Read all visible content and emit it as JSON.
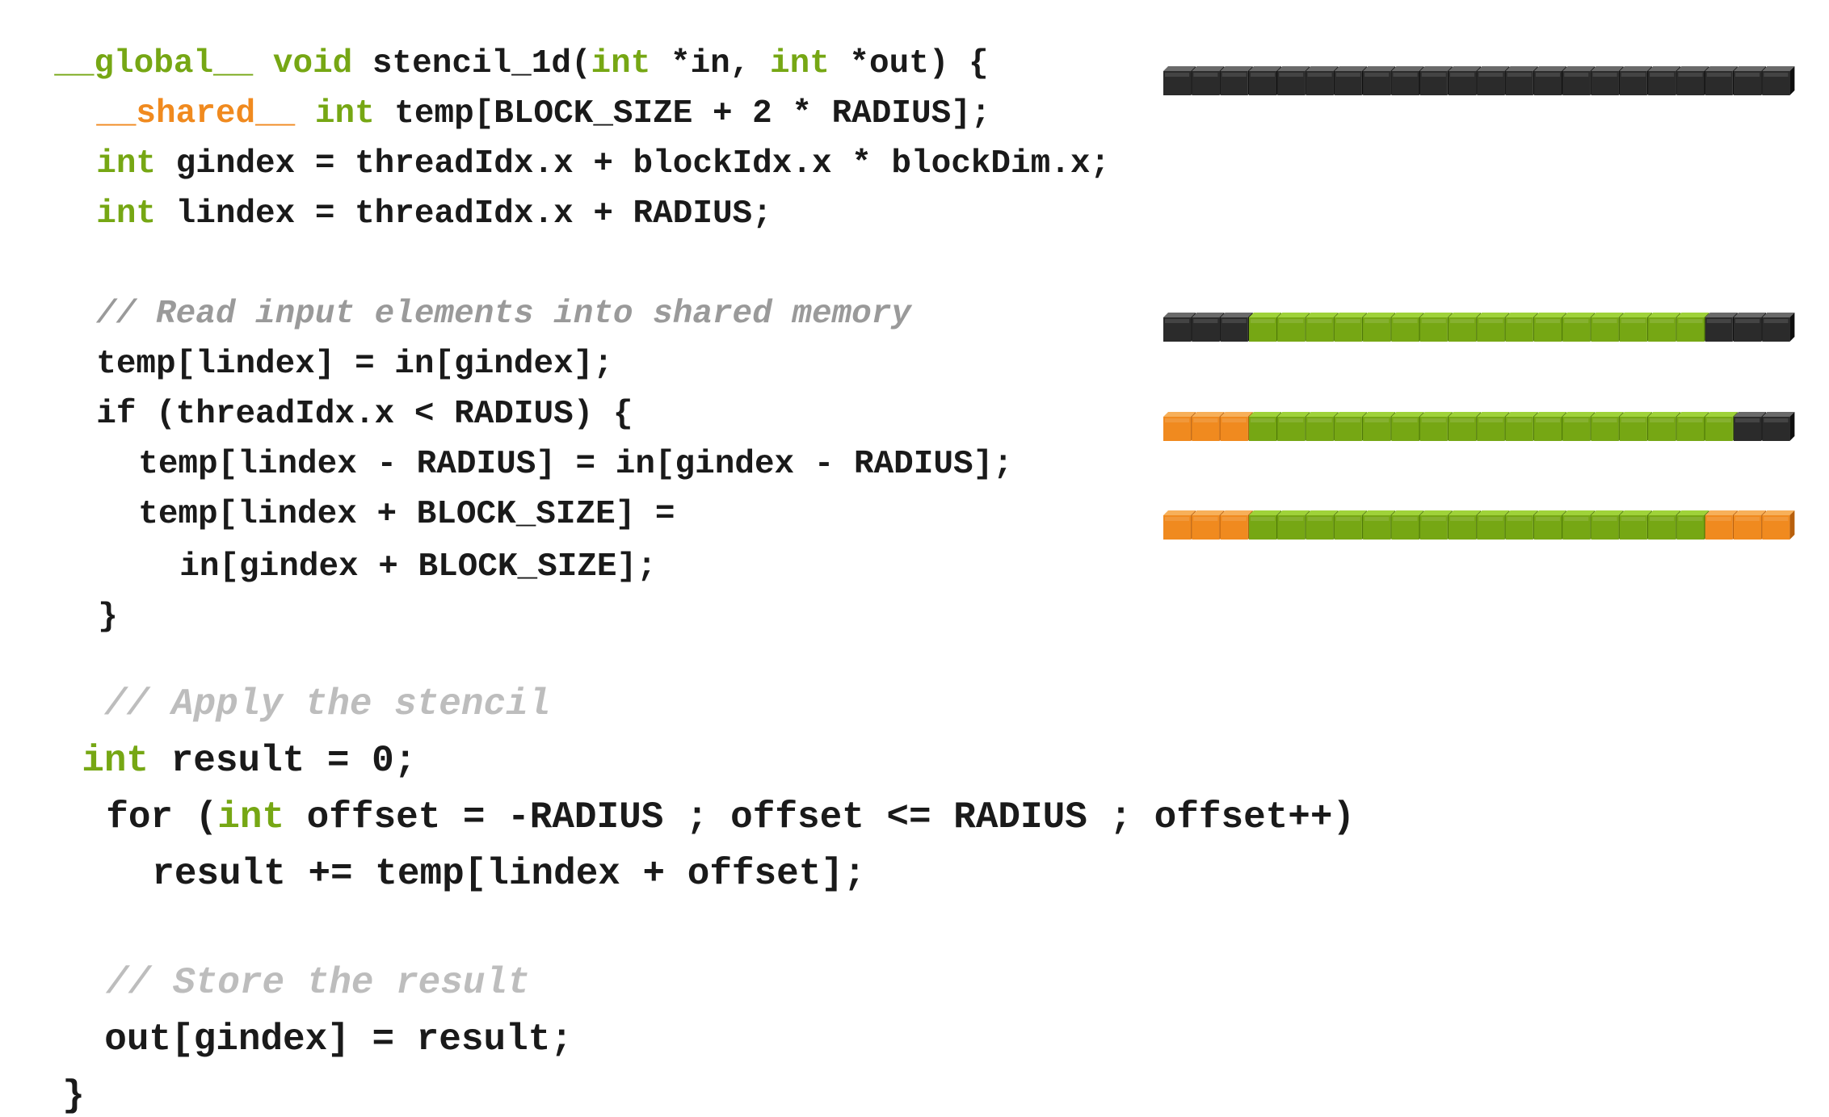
{
  "code": {
    "lines": [
      {
        "id": "l1",
        "size": "s1",
        "tokens": [
          {
            "text": "__global__",
            "c": "green"
          },
          {
            "text": " "
          },
          {
            "text": "void",
            "c": "green"
          },
          {
            "text": " stencil_1d("
          },
          {
            "text": "int",
            "c": "green"
          },
          {
            "text": " *in, "
          },
          {
            "text": "int",
            "c": "green"
          },
          {
            "text": " *out) {"
          }
        ]
      },
      {
        "id": "l2",
        "size": "s1",
        "tokens": [
          {
            "text": "__shared__",
            "c": "orange"
          },
          {
            "text": " "
          },
          {
            "text": "int",
            "c": "green"
          },
          {
            "text": " temp[BLOCK_SIZE + 2 * RADIUS];"
          }
        ]
      },
      {
        "id": "l3",
        "size": "s1",
        "tokens": [
          {
            "text": "int",
            "c": "green"
          },
          {
            "text": " gindex = threadIdx.x + blockIdx.x * blockDim.x;"
          }
        ]
      },
      {
        "id": "l4",
        "size": "s1",
        "tokens": [
          {
            "text": "int",
            "c": "green"
          },
          {
            "text": " lindex = threadIdx.x + RADIUS;"
          }
        ]
      },
      {
        "id": "l5",
        "size": "s1",
        "tokens": [
          {
            "text": "// Read input elements into shared memory",
            "c": "comment"
          }
        ]
      },
      {
        "id": "l6",
        "size": "s1",
        "tokens": [
          {
            "text": "temp[lindex] = in[gindex];"
          }
        ]
      },
      {
        "id": "l7",
        "size": "s1",
        "tokens": [
          {
            "text": "if (threadIdx.x < RADIUS) {"
          }
        ]
      },
      {
        "id": "l8",
        "size": "s1",
        "tokens": [
          {
            "text": "temp[lindex - RADIUS] = in[gindex - RADIUS];"
          }
        ]
      },
      {
        "id": "l9",
        "size": "s1",
        "tokens": [
          {
            "text": "temp[lindex + BLOCK_SIZE] ="
          }
        ]
      },
      {
        "id": "l10",
        "size": "s1",
        "tokens": [
          {
            "text": "in[gindex + BLOCK_SIZE];"
          }
        ]
      },
      {
        "id": "l11",
        "size": "s1",
        "tokens": [
          {
            "text": "}"
          }
        ]
      },
      {
        "id": "l12",
        "size": "s2",
        "tokens": [
          {
            "text": "// Apply the stencil",
            "c": "comment-light"
          }
        ]
      },
      {
        "id": "l13",
        "size": "s2",
        "tokens": [
          {
            "text": "int",
            "c": "green"
          },
          {
            "text": " result = 0;"
          }
        ]
      },
      {
        "id": "l14",
        "size": "s2",
        "tokens": [
          {
            "text": "for ("
          },
          {
            "text": "int",
            "c": "green"
          },
          {
            "text": " offset = -RADIUS ; offset <= RADIUS ; offset++)"
          }
        ]
      },
      {
        "id": "l15",
        "size": "s2",
        "tokens": [
          {
            "text": "result += temp[lindex + offset];"
          }
        ]
      },
      {
        "id": "l16",
        "size": "s2",
        "tokens": [
          {
            "text": "// Store the result",
            "c": "comment-light"
          }
        ]
      },
      {
        "id": "l17",
        "size": "s2",
        "tokens": [
          {
            "text": "out[gindex] = result;"
          }
        ]
      },
      {
        "id": "l18",
        "size": "s2",
        "tokens": [
          {
            "text": "}"
          }
        ]
      }
    ]
  },
  "memory_rows": [
    {
      "id": "row-shared-alloc",
      "cells": "kkkkkkkkkkkkkkkkkkkkkk"
    },
    {
      "id": "row-read-input",
      "cells": "kkkggggggggggggggggkkk"
    },
    {
      "id": "row-left-halo",
      "cells": "ooogggggggggggggggggkkk"
    },
    {
      "id": "row-right-halo",
      "cells": "oooggggggggggggggggooo"
    }
  ],
  "colors": {
    "green": "#76a714",
    "orange": "#f08a1f",
    "black": "#2b2b2b",
    "comment": "#9a9a9a",
    "comment_light": "#bdbdbd",
    "text": "#1a1a1a"
  }
}
